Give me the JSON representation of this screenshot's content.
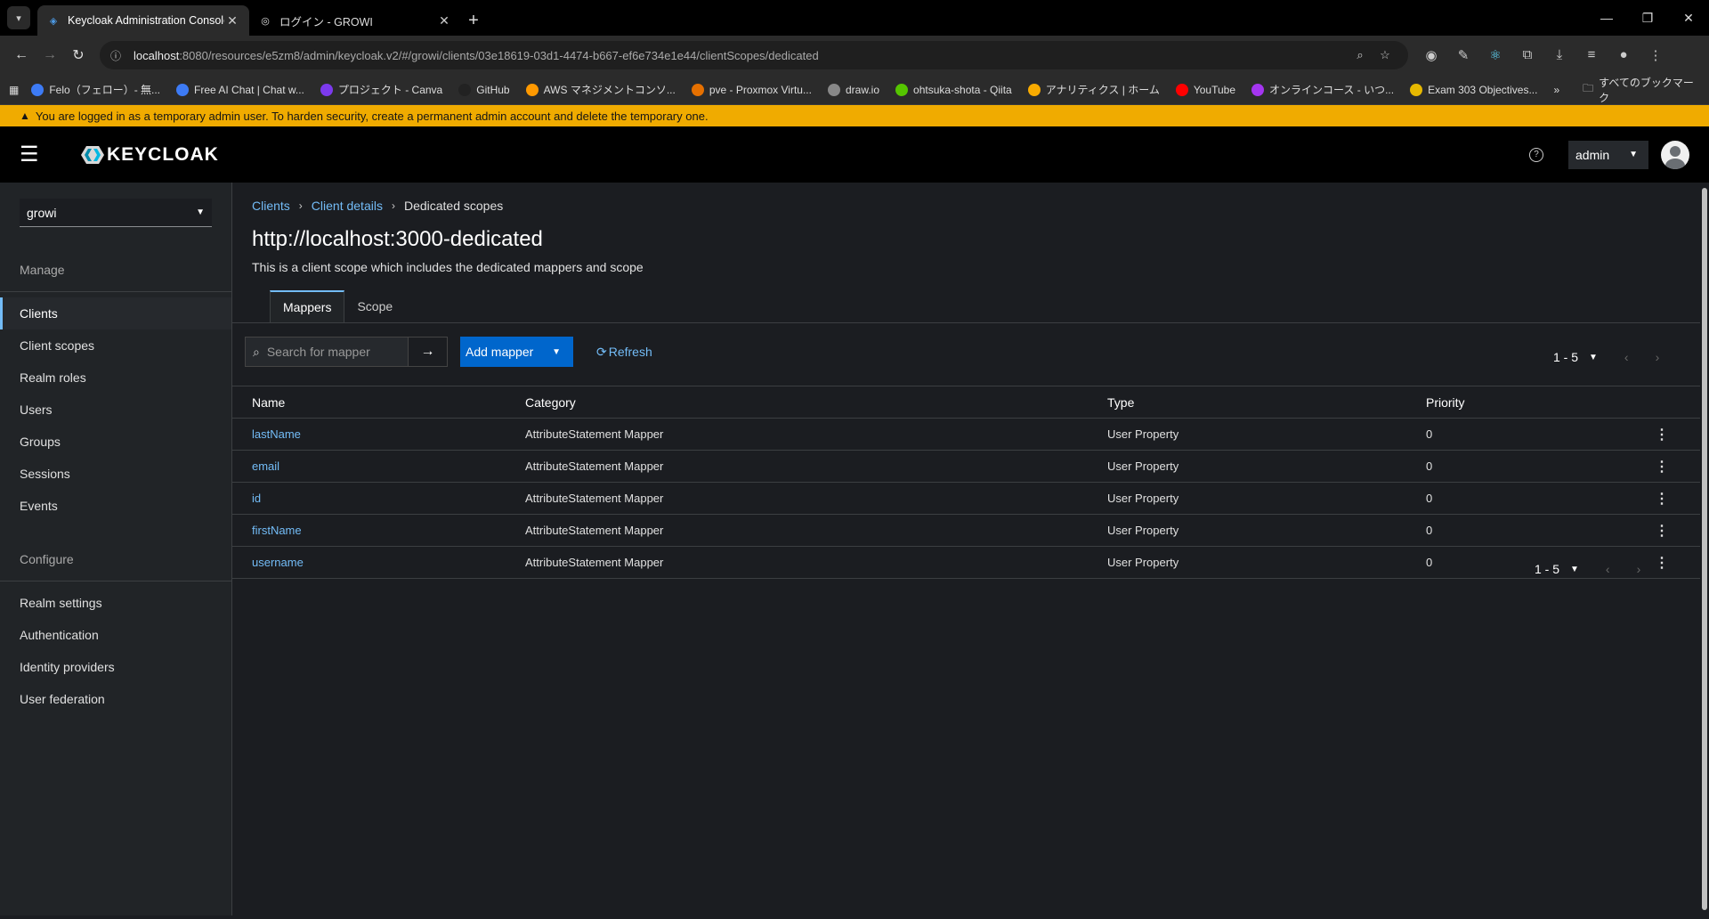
{
  "browser": {
    "tabs": [
      {
        "title": "Keycloak Administration Console",
        "active": true
      },
      {
        "title": "ログイン - GROWI",
        "active": false
      }
    ],
    "url_host": "localhost",
    "url_rest": ":8080/resources/e5zm8/admin/keycloak.v2/#/growi/clients/03e18619-03d1-4474-b667-ef6e734e1e44/clientScopes/dedicated",
    "bookmarks": [
      {
        "label": "Felo（フェロー）- 無...",
        "color": "#3d7bf5"
      },
      {
        "label": "Free AI Chat | Chat w...",
        "color": "#3d7bf5"
      },
      {
        "label": "プロジェクト - Canva",
        "color": "#7c3aed"
      },
      {
        "label": "GitHub",
        "color": "#222222"
      },
      {
        "label": "AWS マネジメントコンソ...",
        "color": "#ff9900"
      },
      {
        "label": "pve - Proxmox Virtu...",
        "color": "#e57000"
      },
      {
        "label": "draw.io",
        "color": "#888888"
      },
      {
        "label": "ohtsuka-shota - Qiita",
        "color": "#55c500"
      },
      {
        "label": "アナリティクス | ホーム",
        "color": "#f9ab00"
      },
      {
        "label": "YouTube",
        "color": "#ff0000"
      },
      {
        "label": "オンラインコース - いつ...",
        "color": "#a435f0"
      },
      {
        "label": "Exam 303 Objectives...",
        "color": "#e6b800"
      }
    ],
    "all_bookmarks": "すべてのブックマーク"
  },
  "banner": {
    "text": "You are logged in as a temporary admin user. To harden security, create a permanent admin account and delete the temporary one."
  },
  "masthead": {
    "brand": "KEYCLOAK",
    "user": "admin"
  },
  "sidebar": {
    "realm": "growi",
    "manage_label": "Manage",
    "manage_items": [
      "Clients",
      "Client scopes",
      "Realm roles",
      "Users",
      "Groups",
      "Sessions",
      "Events"
    ],
    "configure_label": "Configure",
    "configure_items": [
      "Realm settings",
      "Authentication",
      "Identity providers",
      "User federation"
    ]
  },
  "breadcrumb": {
    "clients": "Clients",
    "client_details": "Client details",
    "current": "Dedicated scopes"
  },
  "page": {
    "title": "http://localhost:3000-dedicated",
    "subtitle": "This is a client scope which includes the dedicated mappers and scope"
  },
  "tabs": [
    "Mappers",
    "Scope"
  ],
  "toolbar": {
    "search_placeholder": "Search for mapper",
    "add_mapper": "Add mapper",
    "refresh": "Refresh",
    "pagination": "1 - 5"
  },
  "table": {
    "headers": [
      "Name",
      "Category",
      "Type",
      "Priority"
    ],
    "rows": [
      {
        "name": "lastName",
        "category": "AttributeStatement Mapper",
        "type": "User Property",
        "priority": "0"
      },
      {
        "name": "email",
        "category": "AttributeStatement Mapper",
        "type": "User Property",
        "priority": "0"
      },
      {
        "name": "id",
        "category": "AttributeStatement Mapper",
        "type": "User Property",
        "priority": "0"
      },
      {
        "name": "firstName",
        "category": "AttributeStatement Mapper",
        "type": "User Property",
        "priority": "0"
      },
      {
        "name": "username",
        "category": "AttributeStatement Mapper",
        "type": "User Property",
        "priority": "0"
      }
    ]
  },
  "colors": {
    "accent": "#73bcf7",
    "primary_button": "#0066cc",
    "banner": "#f0ab00",
    "background": "#1b1d21"
  }
}
